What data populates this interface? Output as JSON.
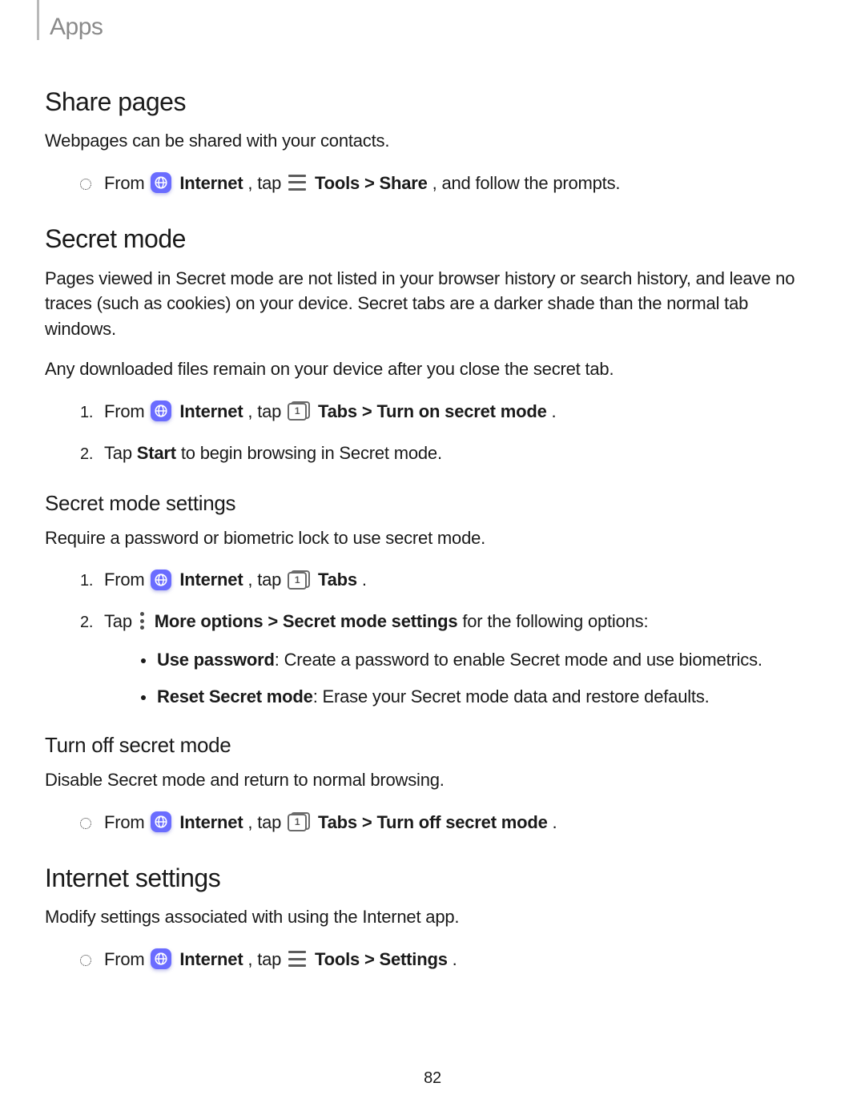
{
  "header": {
    "section": "Apps"
  },
  "page_number": "82",
  "share_pages": {
    "title": "Share pages",
    "intro": "Webpages can be shared with your contacts.",
    "step1": {
      "pre": "From ",
      "app": "Internet",
      "mid": ", tap ",
      "tools": "Tools",
      "gt": " > ",
      "share": "Share",
      "post": ", and follow the prompts."
    }
  },
  "secret_mode": {
    "title": "Secret mode",
    "p1": "Pages viewed in Secret mode are not listed in your browser history or search history, and leave no traces (such as cookies) on your device. Secret tabs are a darker shade than the normal tab windows.",
    "p2": "Any downloaded files remain on your device after you close the secret tab.",
    "step1": {
      "num": "1.",
      "pre": "From ",
      "app": "Internet",
      "mid": ", tap ",
      "tabs": "Tabs",
      "gt": " > ",
      "turn_on": "Turn on secret mode",
      "period": "."
    },
    "step2": {
      "num": "2.",
      "pre": "Tap ",
      "start": "Start",
      "post": " to begin browsing in Secret mode."
    }
  },
  "secret_mode_settings": {
    "title": "Secret mode settings",
    "intro": "Require a password or biometric lock to use secret mode.",
    "step1": {
      "num": "1.",
      "pre": "From ",
      "app": "Internet",
      "mid": ", tap ",
      "tabs": "Tabs",
      "period": "."
    },
    "step2": {
      "num": "2.",
      "pre": "Tap ",
      "more": "More options",
      "gt": " > ",
      "sms": "Secret mode settings",
      "post": " for the following options:"
    },
    "opt1": {
      "label": "Use password",
      "desc": ": Create a password to enable Secret mode and use biometrics."
    },
    "opt2": {
      "label": "Reset Secret mode",
      "desc": ": Erase your Secret mode data and restore defaults."
    }
  },
  "turn_off": {
    "title": "Turn off secret mode",
    "intro": "Disable Secret mode and return to normal browsing.",
    "step1": {
      "pre": "From ",
      "app": "Internet",
      "mid": ", tap ",
      "tabs": "Tabs",
      "gt": " > ",
      "off": "Turn off secret mode",
      "period": "."
    }
  },
  "internet_settings": {
    "title": "Internet settings",
    "intro": "Modify settings associated with using the Internet app.",
    "step1": {
      "pre": "From ",
      "app": "Internet",
      "mid": ", tap ",
      "tools": "Tools",
      "gt": " > ",
      "settings": "Settings",
      "period": "."
    }
  },
  "icons": {
    "tabs_digit": "1"
  }
}
